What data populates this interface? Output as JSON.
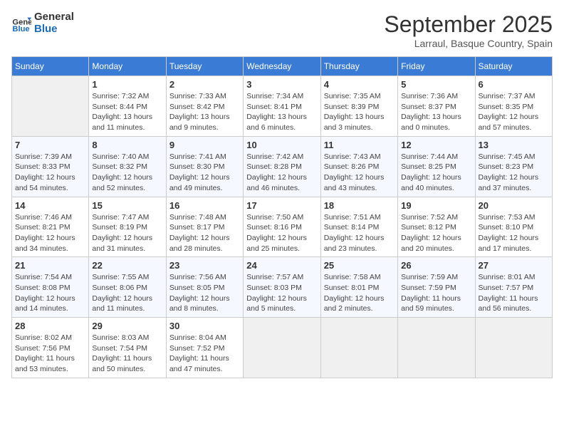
{
  "header": {
    "logo_line1": "General",
    "logo_line2": "Blue",
    "month": "September 2025",
    "location": "Larraul, Basque Country, Spain"
  },
  "weekdays": [
    "Sunday",
    "Monday",
    "Tuesday",
    "Wednesday",
    "Thursday",
    "Friday",
    "Saturday"
  ],
  "weeks": [
    [
      {
        "empty": true
      },
      {
        "day": "1",
        "sunrise": "Sunrise: 7:32 AM",
        "sunset": "Sunset: 8:44 PM",
        "daylight": "Daylight: 13 hours and 11 minutes."
      },
      {
        "day": "2",
        "sunrise": "Sunrise: 7:33 AM",
        "sunset": "Sunset: 8:42 PM",
        "daylight": "Daylight: 13 hours and 9 minutes."
      },
      {
        "day": "3",
        "sunrise": "Sunrise: 7:34 AM",
        "sunset": "Sunset: 8:41 PM",
        "daylight": "Daylight: 13 hours and 6 minutes."
      },
      {
        "day": "4",
        "sunrise": "Sunrise: 7:35 AM",
        "sunset": "Sunset: 8:39 PM",
        "daylight": "Daylight: 13 hours and 3 minutes."
      },
      {
        "day": "5",
        "sunrise": "Sunrise: 7:36 AM",
        "sunset": "Sunset: 8:37 PM",
        "daylight": "Daylight: 13 hours and 0 minutes."
      },
      {
        "day": "6",
        "sunrise": "Sunrise: 7:37 AM",
        "sunset": "Sunset: 8:35 PM",
        "daylight": "Daylight: 12 hours and 57 minutes."
      }
    ],
    [
      {
        "day": "7",
        "sunrise": "Sunrise: 7:39 AM",
        "sunset": "Sunset: 8:33 PM",
        "daylight": "Daylight: 12 hours and 54 minutes."
      },
      {
        "day": "8",
        "sunrise": "Sunrise: 7:40 AM",
        "sunset": "Sunset: 8:32 PM",
        "daylight": "Daylight: 12 hours and 52 minutes."
      },
      {
        "day": "9",
        "sunrise": "Sunrise: 7:41 AM",
        "sunset": "Sunset: 8:30 PM",
        "daylight": "Daylight: 12 hours and 49 minutes."
      },
      {
        "day": "10",
        "sunrise": "Sunrise: 7:42 AM",
        "sunset": "Sunset: 8:28 PM",
        "daylight": "Daylight: 12 hours and 46 minutes."
      },
      {
        "day": "11",
        "sunrise": "Sunrise: 7:43 AM",
        "sunset": "Sunset: 8:26 PM",
        "daylight": "Daylight: 12 hours and 43 minutes."
      },
      {
        "day": "12",
        "sunrise": "Sunrise: 7:44 AM",
        "sunset": "Sunset: 8:25 PM",
        "daylight": "Daylight: 12 hours and 40 minutes."
      },
      {
        "day": "13",
        "sunrise": "Sunrise: 7:45 AM",
        "sunset": "Sunset: 8:23 PM",
        "daylight": "Daylight: 12 hours and 37 minutes."
      }
    ],
    [
      {
        "day": "14",
        "sunrise": "Sunrise: 7:46 AM",
        "sunset": "Sunset: 8:21 PM",
        "daylight": "Daylight: 12 hours and 34 minutes."
      },
      {
        "day": "15",
        "sunrise": "Sunrise: 7:47 AM",
        "sunset": "Sunset: 8:19 PM",
        "daylight": "Daylight: 12 hours and 31 minutes."
      },
      {
        "day": "16",
        "sunrise": "Sunrise: 7:48 AM",
        "sunset": "Sunset: 8:17 PM",
        "daylight": "Daylight: 12 hours and 28 minutes."
      },
      {
        "day": "17",
        "sunrise": "Sunrise: 7:50 AM",
        "sunset": "Sunset: 8:16 PM",
        "daylight": "Daylight: 12 hours and 25 minutes."
      },
      {
        "day": "18",
        "sunrise": "Sunrise: 7:51 AM",
        "sunset": "Sunset: 8:14 PM",
        "daylight": "Daylight: 12 hours and 23 minutes."
      },
      {
        "day": "19",
        "sunrise": "Sunrise: 7:52 AM",
        "sunset": "Sunset: 8:12 PM",
        "daylight": "Daylight: 12 hours and 20 minutes."
      },
      {
        "day": "20",
        "sunrise": "Sunrise: 7:53 AM",
        "sunset": "Sunset: 8:10 PM",
        "daylight": "Daylight: 12 hours and 17 minutes."
      }
    ],
    [
      {
        "day": "21",
        "sunrise": "Sunrise: 7:54 AM",
        "sunset": "Sunset: 8:08 PM",
        "daylight": "Daylight: 12 hours and 14 minutes."
      },
      {
        "day": "22",
        "sunrise": "Sunrise: 7:55 AM",
        "sunset": "Sunset: 8:06 PM",
        "daylight": "Daylight: 12 hours and 11 minutes."
      },
      {
        "day": "23",
        "sunrise": "Sunrise: 7:56 AM",
        "sunset": "Sunset: 8:05 PM",
        "daylight": "Daylight: 12 hours and 8 minutes."
      },
      {
        "day": "24",
        "sunrise": "Sunrise: 7:57 AM",
        "sunset": "Sunset: 8:03 PM",
        "daylight": "Daylight: 12 hours and 5 minutes."
      },
      {
        "day": "25",
        "sunrise": "Sunrise: 7:58 AM",
        "sunset": "Sunset: 8:01 PM",
        "daylight": "Daylight: 12 hours and 2 minutes."
      },
      {
        "day": "26",
        "sunrise": "Sunrise: 7:59 AM",
        "sunset": "Sunset: 7:59 PM",
        "daylight": "Daylight: 11 hours and 59 minutes."
      },
      {
        "day": "27",
        "sunrise": "Sunrise: 8:01 AM",
        "sunset": "Sunset: 7:57 PM",
        "daylight": "Daylight: 11 hours and 56 minutes."
      }
    ],
    [
      {
        "day": "28",
        "sunrise": "Sunrise: 8:02 AM",
        "sunset": "Sunset: 7:56 PM",
        "daylight": "Daylight: 11 hours and 53 minutes."
      },
      {
        "day": "29",
        "sunrise": "Sunrise: 8:03 AM",
        "sunset": "Sunset: 7:54 PM",
        "daylight": "Daylight: 11 hours and 50 minutes."
      },
      {
        "day": "30",
        "sunrise": "Sunrise: 8:04 AM",
        "sunset": "Sunset: 7:52 PM",
        "daylight": "Daylight: 11 hours and 47 minutes."
      },
      {
        "empty": true
      },
      {
        "empty": true
      },
      {
        "empty": true
      },
      {
        "empty": true
      }
    ]
  ]
}
